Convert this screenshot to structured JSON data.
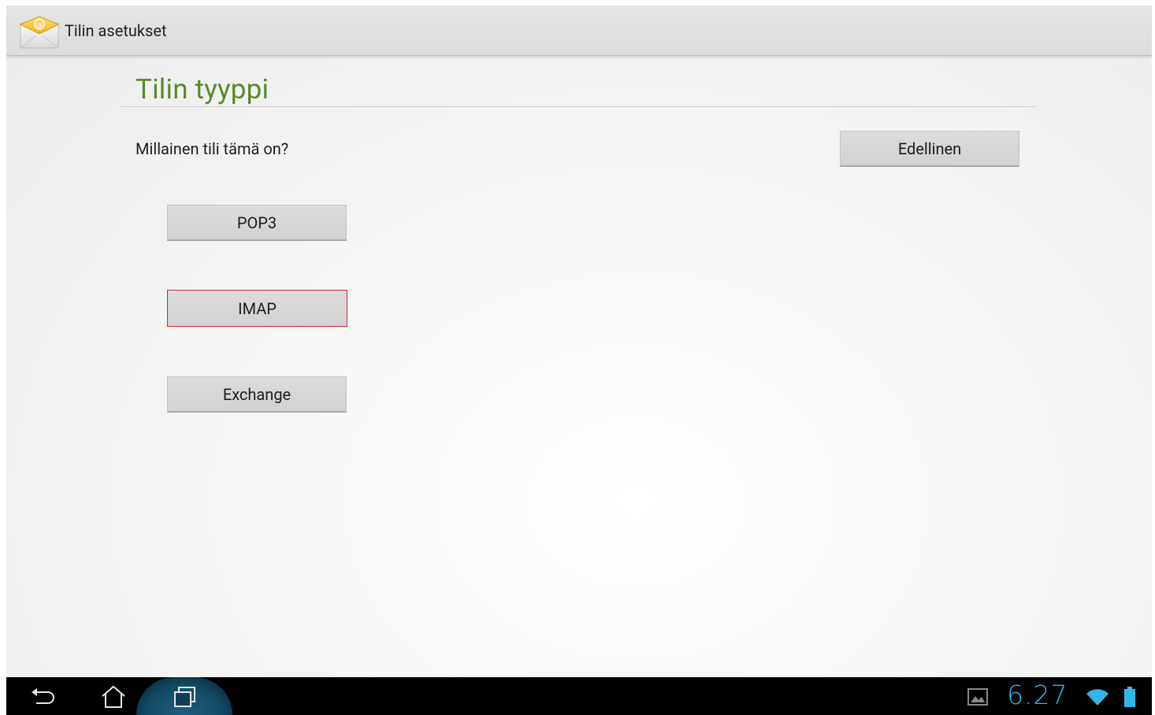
{
  "action_bar": {
    "title": "Tilin asetukset",
    "app_icon": "email-icon"
  },
  "page": {
    "title": "Tilin tyyppi",
    "question": "Millainen tili tämä on?"
  },
  "buttons": {
    "previous": "Edellinen",
    "pop3": "POP3",
    "imap": "IMAP",
    "exchange": "Exchange"
  },
  "system_bar": {
    "clock": "6.27",
    "icons": [
      "back-icon",
      "home-icon",
      "recent-apps-icon",
      "screenshot-notification-icon",
      "wifi-icon",
      "battery-icon"
    ]
  },
  "colors": {
    "title_green": "#5b8a2a",
    "clock_blue": "#33b5e5",
    "focus_red": "#d8262c"
  }
}
